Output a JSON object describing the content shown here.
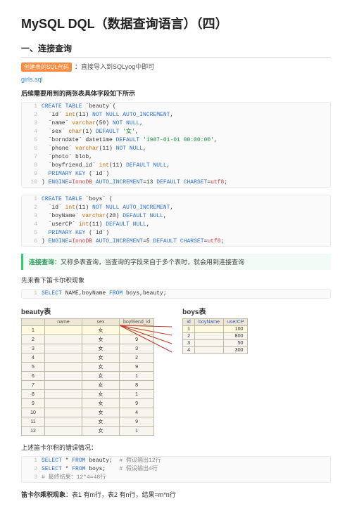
{
  "title": "MySQL DQL（数据查询语言）（四）",
  "section1_heading": "一、连接查询",
  "tag_text": "创建表的SQL代码",
  "intro_after_tag": "：直接导入到SQLyog中即可",
  "link_text": "girls.sql",
  "bold1": "后续需要用到的两张表具体字段如下所示",
  "code_beauty": [
    "CREATE TABLE `beauty`(",
    "  `id` int(11) NOT NULL AUTO_INCREMENT,",
    "  `name` varchar(50) NOT NULL,",
    "  `sex` char(1) DEFAULT '女',",
    "  `borndate` datetime DEFAULT '1987-01-01 00:00:00',",
    "  `phone` varchar(11) NOT NULL,",
    "  `photo` blob,",
    "  `boyfriend_id` int(11) DEFAULT NULL,",
    "  PRIMARY KEY (`id`)",
    ") ENGINE=InnoDB AUTO_INCREMENT=13 DEFAULT CHARSET=utf8;"
  ],
  "code_boys": [
    "CREATE TABLE `boys` (",
    "  `id` int(11) NOT NULL AUTO_INCREMENT,",
    "  `boyName` varchar(20) DEFAULT NULL,",
    "  `userCP` int(11) DEFAULT NULL,",
    "  PRIMARY KEY (`id`)",
    ") ENGINE=InnoDB AUTO_INCREMENT=5 DEFAULT CHARSET=utf8;"
  ],
  "callout_tag": "连接查询",
  "callout_text": "：又称多表查询，当查询的字段来自于多个表时，就会用到连接查询",
  "plain1": "先来看下笛卡尔积现象",
  "code_select1": [
    "SELECT NAME,boyName FROM boys,beauty;"
  ],
  "beauty_caption": "beauty表",
  "boys_caption": "boys表",
  "beauty_headers": [
    "name",
    "sex",
    "boyfriend_id"
  ],
  "beauty_rows": [
    [
      "1",
      "",
      "女",
      ""
    ],
    [
      "2",
      "",
      "女",
      "9"
    ],
    [
      "3",
      "",
      "女",
      "3"
    ],
    [
      "4",
      "",
      "女",
      "2"
    ],
    [
      "5",
      "",
      "女",
      "9"
    ],
    [
      "6",
      "",
      "女",
      "1"
    ],
    [
      "7",
      "",
      "女",
      "8"
    ],
    [
      "8",
      "",
      "女",
      "1"
    ],
    [
      "9",
      "",
      "女",
      "9"
    ],
    [
      "10",
      "",
      "女",
      "4"
    ],
    [
      "11",
      "",
      "女",
      "9"
    ],
    [
      "12",
      "",
      "女",
      "1"
    ]
  ],
  "boys_headers": [
    "id",
    "boyName",
    "userCP"
  ],
  "boys_rows": [
    [
      "1",
      "",
      "100"
    ],
    [
      "2",
      "",
      "800"
    ],
    [
      "3",
      "",
      "50"
    ],
    [
      "4",
      "",
      "300"
    ]
  ],
  "plain2": "上述笛卡尔积的错误情况：",
  "code_err": [
    "SELECT * FROM beauty;  # 假设输出12行",
    "SELECT * FROM boys;    # 假设输出4行",
    "# 最终结果：12*4=48行"
  ],
  "final_bold": "笛卡尔乘积现象",
  "final_rest": "：表1 有m行，表2 有n行，结果=m*n行"
}
